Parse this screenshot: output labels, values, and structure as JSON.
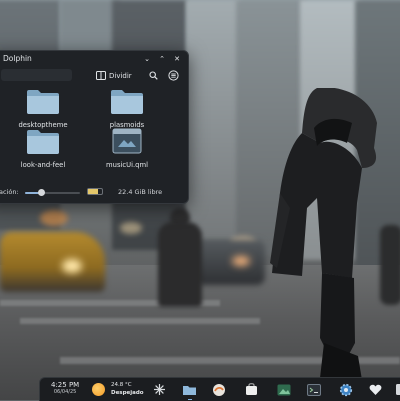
{
  "window": {
    "title": "Dolphin",
    "split_label": "Dividir",
    "close_glyph": "✕",
    "minimize_glyph": "⌄",
    "maximize_glyph": "⌃"
  },
  "files": [
    {
      "name": "desktoptheme",
      "icon": "folder-icon"
    },
    {
      "name": "plasmoids",
      "icon": "folder-icon"
    },
    {
      "name": "look-and-feel",
      "icon": "folder-icon"
    },
    {
      "name": "musicUi.qml",
      "icon": "qml-file-icon"
    }
  ],
  "statusbar": {
    "zoom_label": "ación:",
    "zoom_level": 0.3,
    "free_space": "22.4 GiB libre",
    "used_fraction": 0.7
  },
  "panel": {
    "time": "4:25 PM",
    "date": "06/04/25",
    "temperature": "24.8 °C",
    "weather": "Despejado",
    "icons": [
      "weather-sun-icon",
      "network-icon",
      "folder-icon",
      "music-player-icon",
      "app-store-icon",
      "image-viewer-icon",
      "terminal-icon",
      "settings-icon",
      "favorite-icon"
    ]
  },
  "colors": {
    "accent": "#7fb0e0",
    "folder": "#a8c7dd",
    "window_bg": "#1f2226"
  }
}
